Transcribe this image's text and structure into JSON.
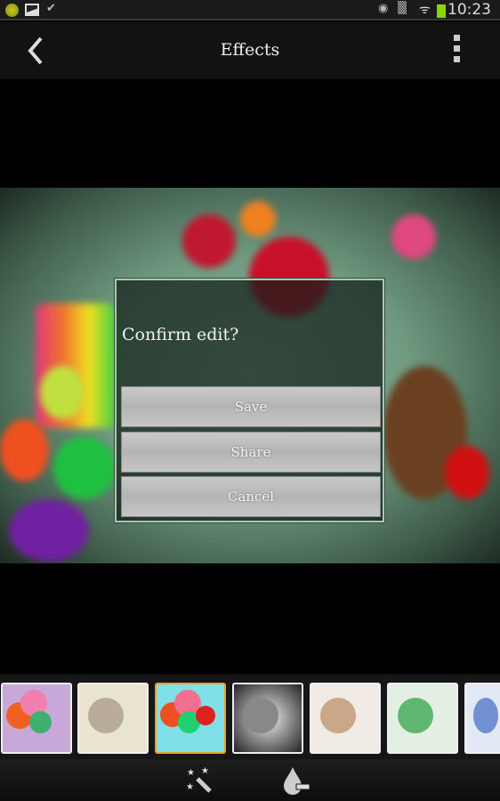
{
  "status_bar": {
    "time": "10:23",
    "icons": [
      "app-notification-icon",
      "gallery-icon",
      "download-done-icon",
      "eye-icon",
      "vibrate-icon",
      "wifi-icon",
      "battery-icon"
    ],
    "battery_color": "#8bd400"
  },
  "action_bar": {
    "title": "Effects",
    "back_icon": "chevron-left-icon",
    "menu_icon": "overflow-menu-icon"
  },
  "dialog": {
    "title": "Confirm edit?",
    "buttons": [
      "Save",
      "Share",
      "Cancel"
    ]
  },
  "effects": {
    "thumbnails": [
      {
        "tint": "#c8a8d8",
        "selected": false
      },
      {
        "tint": "#e8e4d0",
        "selected": false
      },
      {
        "tint": "#7fe0e8",
        "selected": true
      },
      {
        "tint": "#d8d8d8",
        "selected": false
      },
      {
        "tint": "#f0ebe4",
        "selected": false
      },
      {
        "tint": "#e4efe4",
        "selected": false
      },
      {
        "tint": "#e2e8f4",
        "selected": false
      }
    ],
    "selected_color": "#f0a020"
  },
  "toolbar": {
    "tools": [
      "magic-wand-icon",
      "color-drop-icon"
    ]
  }
}
